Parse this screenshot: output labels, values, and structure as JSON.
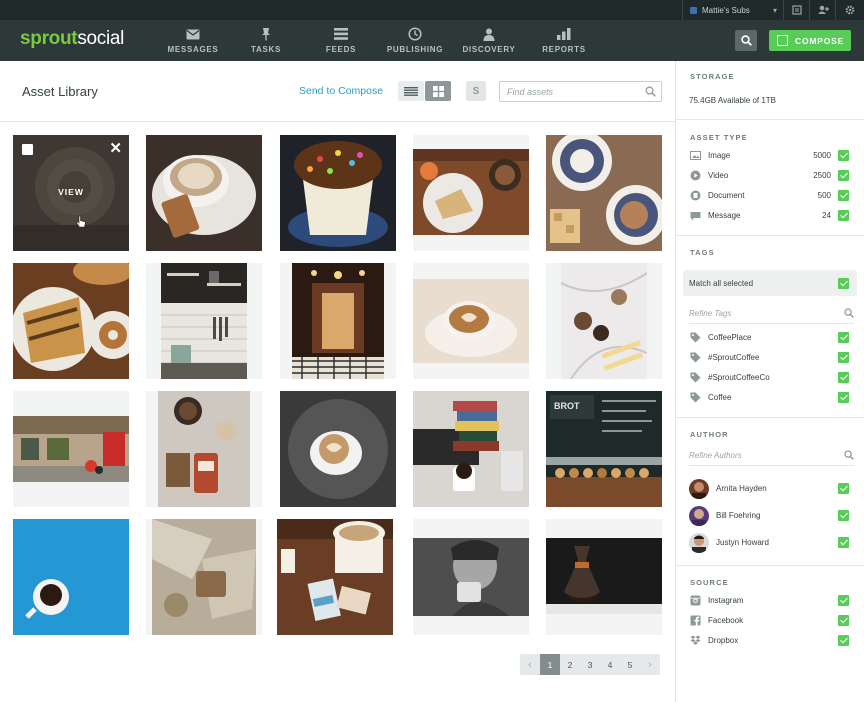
{
  "topbar": {
    "account": "Mattie's Subs"
  },
  "nav": {
    "logo_a": "sprout",
    "logo_b": "social",
    "items": [
      {
        "label": "MESSAGES",
        "icon": "messages-icon"
      },
      {
        "label": "TASKS",
        "icon": "pin-icon"
      },
      {
        "label": "FEEDS",
        "icon": "feeds-icon"
      },
      {
        "label": "PUBLISHING",
        "icon": "publishing-icon"
      },
      {
        "label": "DISCOVERY",
        "icon": "discovery-icon"
      },
      {
        "label": "REPORTS",
        "icon": "reports-icon"
      }
    ],
    "compose": "COMPOSE"
  },
  "header": {
    "title": "Asset Library",
    "send_to_compose": "Send to Compose",
    "s_label": "S",
    "search_placeholder": "Find assets"
  },
  "grid": {
    "hover_label": "VIEW"
  },
  "pager": {
    "pages": [
      "1",
      "2",
      "3",
      "4",
      "5"
    ],
    "current": "1",
    "prev": "‹",
    "next": "›"
  },
  "sidebar": {
    "storage": {
      "heading": "STORAGE",
      "text": "75.4GB Available of 1TB"
    },
    "asset_type": {
      "heading": "ASSET TYPE",
      "items": [
        {
          "label": "Image",
          "count": "5000",
          "icon": "image-icon"
        },
        {
          "label": "Video",
          "count": "2500",
          "icon": "video-icon"
        },
        {
          "label": "Document",
          "count": "500",
          "icon": "document-icon"
        },
        {
          "label": "Message",
          "count": "24",
          "icon": "message-icon"
        }
      ]
    },
    "tags": {
      "heading": "TAGS",
      "match_all": "Match all selected",
      "refine_placeholder": "Refine Tags",
      "items": [
        "CoffeePlace",
        "#SproutCoffee",
        "#SproutCoffeeCo",
        "Coffee"
      ]
    },
    "author": {
      "heading": "AUTHOR",
      "refine_placeholder": "Refine Authors",
      "items": [
        "Arnita Hayden",
        "Bill Foehring",
        "Justyn Howard"
      ]
    },
    "source": {
      "heading": "SOURCE",
      "items": [
        {
          "label": "Instagram",
          "icon": "instagram-icon"
        },
        {
          "label": "Facebook",
          "icon": "facebook-icon"
        },
        {
          "label": "Dropbox",
          "icon": "dropbox-icon"
        }
      ]
    }
  },
  "colors": {
    "accent_green": "#59cb59",
    "link_blue": "#2b9dbf",
    "nav_bg": "#2d3838"
  }
}
